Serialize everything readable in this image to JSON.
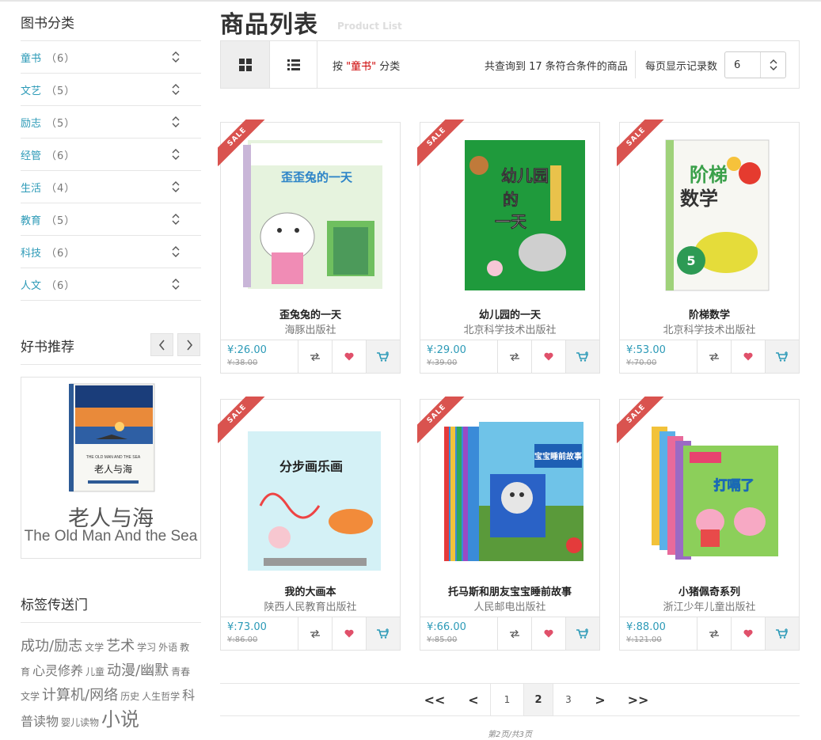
{
  "sidebar": {
    "category_title": "图书分类",
    "categories": [
      {
        "label": "童书",
        "count": "（6）"
      },
      {
        "label": "文艺",
        "count": "（5）"
      },
      {
        "label": "励志",
        "count": "（5）"
      },
      {
        "label": "经管",
        "count": "（6）"
      },
      {
        "label": "生活",
        "count": "（4）"
      },
      {
        "label": "教育",
        "count": "（5）"
      },
      {
        "label": "科技",
        "count": "（6）"
      },
      {
        "label": "人文",
        "count": "（6）"
      }
    ],
    "recommend_title": "好书推荐",
    "recommend": {
      "name_cn": "老人与海",
      "name_en": "The Old Man And the Sea",
      "cover_text_en": "THE OLD MAN AND THE SEA",
      "cover_text_cn": "老人与海"
    },
    "tag_title": "标签传送门",
    "tags": [
      {
        "text": "成功/励志",
        "size": "large"
      },
      {
        "text": "文学",
        "size": "small"
      },
      {
        "text": "艺术",
        "size": "large"
      },
      {
        "text": "学习",
        "size": "small"
      },
      {
        "text": "外语",
        "size": "small"
      },
      {
        "text": "教育",
        "size": "small"
      },
      {
        "text": "心灵修养",
        "size": "medium"
      },
      {
        "text": "儿童",
        "size": "small"
      },
      {
        "text": "动漫/幽默",
        "size": "large"
      },
      {
        "text": "青春文学",
        "size": "small"
      },
      {
        "text": "计算机/网络",
        "size": "large"
      },
      {
        "text": "历史",
        "size": "small"
      },
      {
        "text": "人生哲学",
        "size": "small"
      },
      {
        "text": "科普读物",
        "size": "medium"
      },
      {
        "text": "婴儿读物",
        "size": "small"
      },
      {
        "text": "小说",
        "size": "xlarge"
      }
    ]
  },
  "main": {
    "title": "商品列表",
    "subtitle": "Product List",
    "filter_prefix": "按 ",
    "filter_keyword": "\"童书\"",
    "filter_suffix": " 分类",
    "result_text": "共查询到 17 条符合条件的商品",
    "per_page_label": "每页显示记录数",
    "per_page_value": "6"
  },
  "sale_label": "SALE",
  "products": [
    {
      "title": "歪兔兔的一天",
      "publisher": "海豚出版社",
      "price": "¥:26.00",
      "old_price": "¥:38.00",
      "cover_title": "歪歪兔的一天",
      "theme": "#8fcf7a"
    },
    {
      "title": "幼儿园的一天",
      "publisher": "北京科学技术出版社",
      "price": "¥:29.00",
      "old_price": "¥:39.00",
      "cover_title": "幼儿园的一天",
      "theme": "#1f9a3c"
    },
    {
      "title": "阶梯数学",
      "publisher": "北京科学技术出版社",
      "price": "¥:53.00",
      "old_price": "¥:70.00",
      "cover_title": "阶梯数学",
      "theme": "#e8e8e8"
    },
    {
      "title": "我的大画本",
      "publisher": "陕西人民教育出版社",
      "price": "¥:73.00",
      "old_price": "¥:86.00",
      "cover_title": "分步画乐画",
      "theme": "#7fd3e8"
    },
    {
      "title": "托马斯和朋友宝宝睡前故事",
      "publisher": "人民邮电出版社",
      "price": "¥:66.00",
      "old_price": "¥:85.00",
      "cover_title": "宝宝睡前故事",
      "theme": "#2a6cc4"
    },
    {
      "title": "小猪佩奇系列",
      "publisher": "浙江少年儿童出版社",
      "price": "¥:88.00",
      "old_price": "¥:121.00",
      "cover_title": "打嗝了",
      "theme": "#8ccf5a"
    }
  ],
  "pagination": {
    "first": "<<",
    "prev": "<",
    "pages": [
      "1",
      "2",
      "3"
    ],
    "current": "2",
    "next": ">",
    "last": ">>",
    "info": "第2页/共3页"
  }
}
